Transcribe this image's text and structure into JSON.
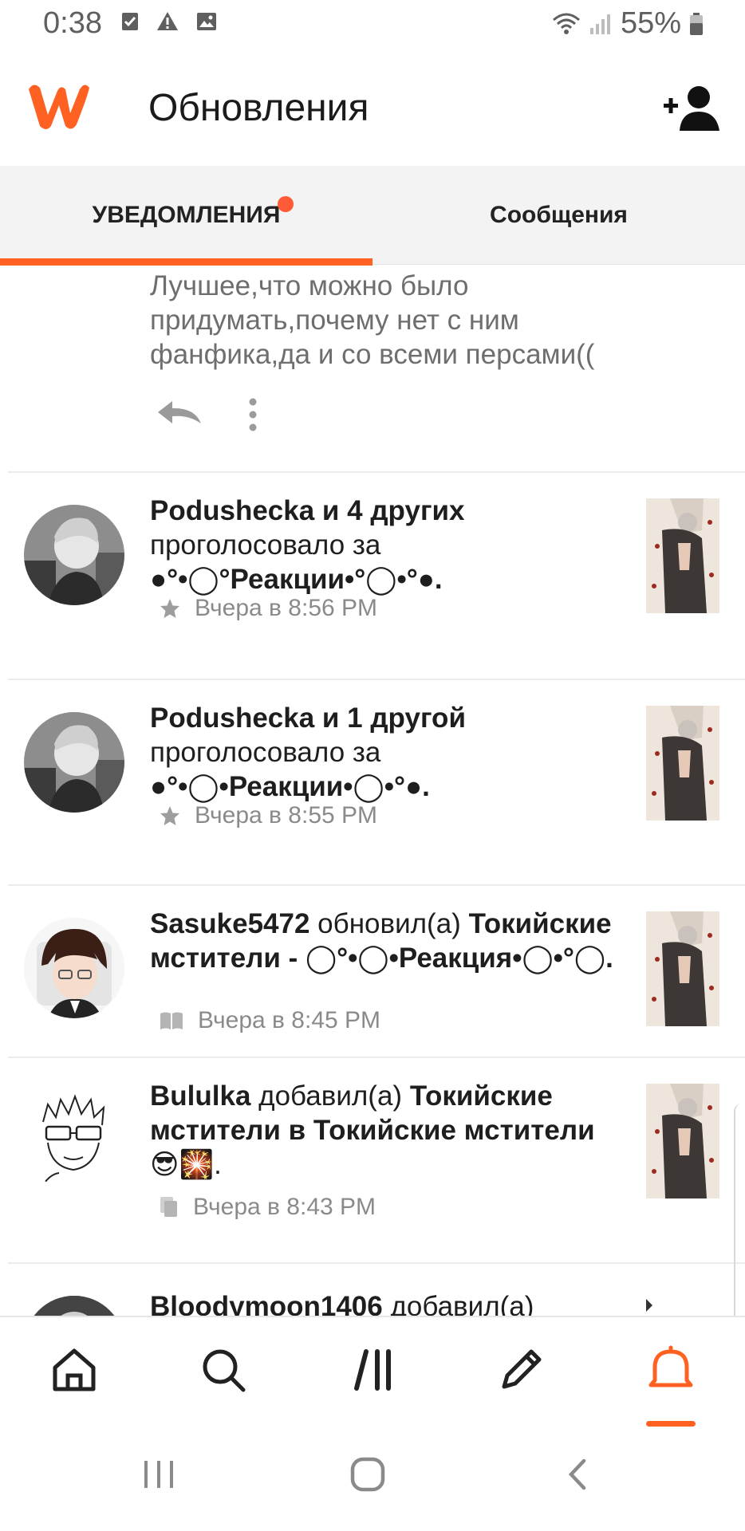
{
  "status_bar": {
    "time": "0:38",
    "battery": "55%",
    "icons": [
      "checkbox-icon",
      "warning-icon",
      "image-icon",
      "wifi-icon",
      "signal-icon",
      "battery-icon"
    ]
  },
  "header": {
    "title": "Обновления",
    "logo": "wattpad-logo",
    "action_icon": "add-friend-icon"
  },
  "tabs": [
    {
      "label": "УВЕДОМЛЕНИЯ",
      "active": true,
      "has_dot": true
    },
    {
      "label": "Сообщения",
      "active": false,
      "has_dot": false
    }
  ],
  "comment": {
    "text": "Лучшее,что можно было придумать,почему нет с ним фанфика,да и со всеми персами(("
  },
  "notifications": [
    {
      "user": "Podushecka и 4 других",
      "action": "проголосовало за",
      "title": "●°•◯°Реакции•°◯•°●.",
      "time": "Вчера в 8:56 PM",
      "meta_icon": "star-icon"
    },
    {
      "user": "Podushecka и 1 другой",
      "action": "проголосовало за",
      "title": "●°•◯•Реакции•◯•°●.",
      "time": "Вчера в 8:55 PM",
      "meta_icon": "star-icon"
    },
    {
      "user": "Sasuke5472",
      "action": " обновил(а) ",
      "title": "Токийские мстители - ◯°•◯•Реакция•◯•°◯.",
      "time": "Вчера в 8:45 PM",
      "meta_icon": "book-icon"
    },
    {
      "user": "Bululka",
      "action": " добавил(а) ",
      "title": "Токийские мстители",
      "connector": " в ",
      "list": "Токийские мстители",
      "emoji": "😎🎇.",
      "time": "Вчера в 8:43 PM",
      "meta_icon": "reading-list-icon"
    },
    {
      "user": "Bloodymoon1406",
      "action": " добавил(а)"
    }
  ],
  "bottom_nav": [
    {
      "label": "home",
      "icon": "home-icon",
      "active": false
    },
    {
      "label": "search",
      "icon": "search-icon",
      "active": false
    },
    {
      "label": "library",
      "icon": "library-icon",
      "active": false
    },
    {
      "label": "write",
      "icon": "pencil-icon",
      "active": false
    },
    {
      "label": "notifications",
      "icon": "bell-icon",
      "active": true
    }
  ],
  "colors": {
    "accent": "#ff6122",
    "dot": "#ff5a36",
    "muted_text": "#8a8a8a"
  }
}
